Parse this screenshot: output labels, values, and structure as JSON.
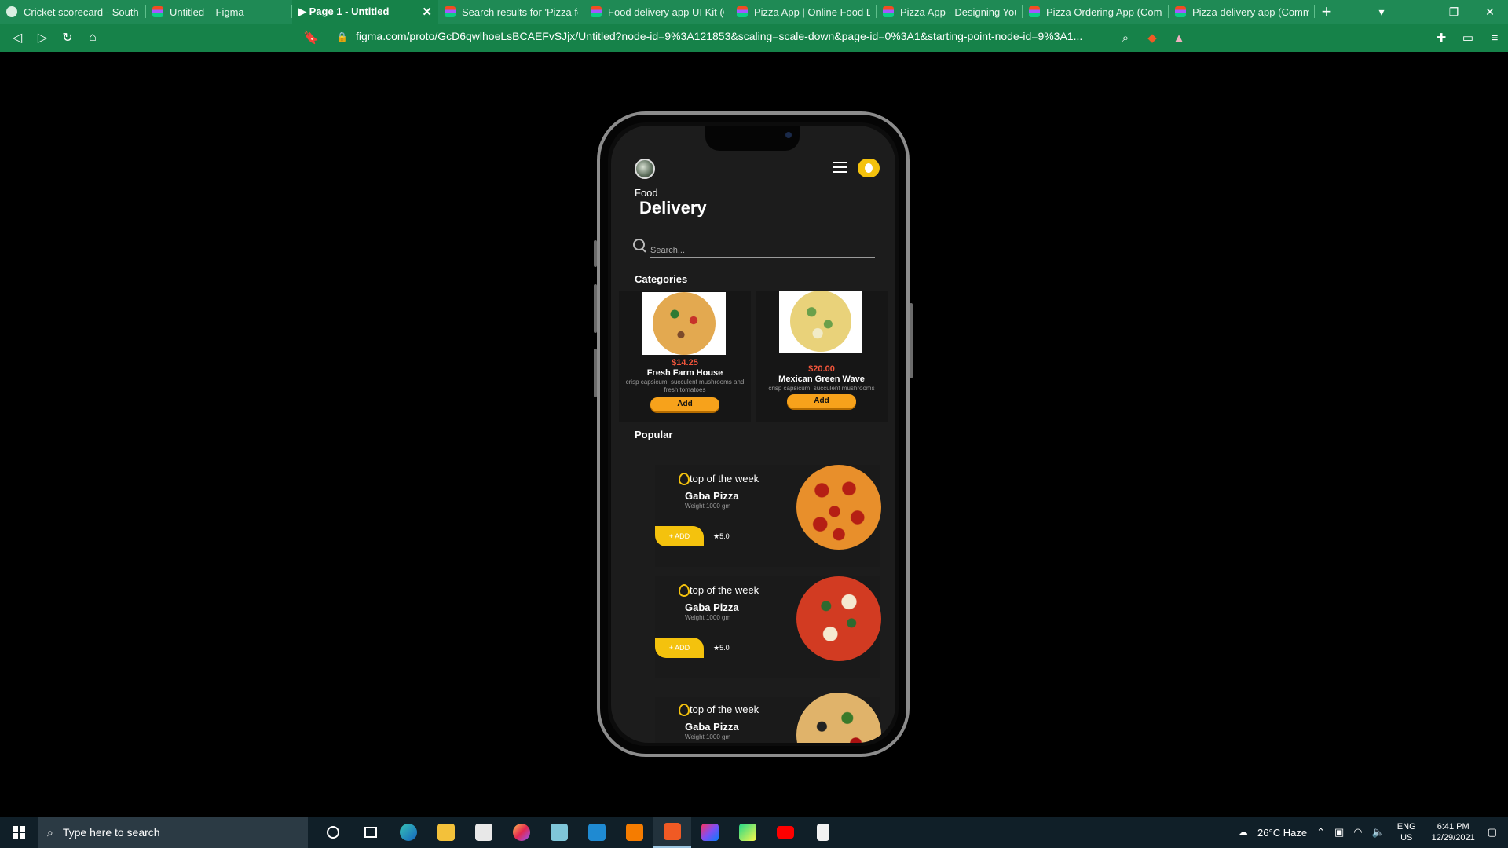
{
  "browser": {
    "tabs": [
      {
        "title": "Cricket scorecard - South Af",
        "icon": "cricket-favicon",
        "active": false
      },
      {
        "title": "Untitled – Figma",
        "icon": "figma-favicon",
        "active": false
      },
      {
        "title": "▶ Page 1 - Untitled",
        "icon": "figma-favicon",
        "active": true,
        "close": "✕"
      },
      {
        "title": "Search results for 'Pizza foo",
        "icon": "figma-favicon",
        "active": false
      },
      {
        "title": "Food delivery app UI Kit (Co",
        "icon": "figma-favicon",
        "active": false
      },
      {
        "title": "Pizza App | Online Food Del",
        "icon": "figma-favicon",
        "active": false
      },
      {
        "title": "Pizza App - Designing Your",
        "icon": "figma-favicon",
        "active": false
      },
      {
        "title": "Pizza Ordering App (Comm",
        "icon": "figma-favicon",
        "active": false
      },
      {
        "title": "Pizza delivery app (Commun",
        "icon": "figma-favicon",
        "active": false
      }
    ],
    "new_tab": "+",
    "window_controls": {
      "menu": "▾",
      "minimize": "—",
      "restore": "❐",
      "close": "✕"
    },
    "nav": {
      "back": "◁",
      "forward": "▷",
      "reload": "↻",
      "home": "⌂",
      "bookmark": "🔖"
    },
    "url": "figma.com/proto/GcD6qwlhoeLsBCAEFvSJjx/Untitled?node-id=9%3A121853&scaling=scale-down&page-id=0%3A1&starting-point-node-id=9%3A1...",
    "accent_color": "#1f8a55"
  },
  "app": {
    "heading_small": "Food",
    "heading_big": "Delivery",
    "search_placeholder": "Search...",
    "categories_title": "Categories",
    "categories": [
      {
        "price": "$14.25",
        "name": "Fresh Farm House",
        "desc": "crisp capsicum, succulent mushrooms and fresh tomatoes",
        "button": "Add"
      },
      {
        "price": "$20.00",
        "name": "Mexican Green Wave",
        "desc": "crisp capsicum, succulent mushrooms",
        "button": "Add"
      }
    ],
    "popular_title": "Popular",
    "popular": [
      {
        "badge": "top of the week",
        "name": "Gaba Pizza",
        "weight": "Weight 1000 gm",
        "add": "+ ADD",
        "rating": "★5.0"
      },
      {
        "badge": "top of the week",
        "name": "Gaba Pizza",
        "weight": "Weight 1000 gm",
        "add": "+ ADD",
        "rating": "★5.0"
      },
      {
        "badge": "top of the week",
        "name": "Gaba Pizza",
        "weight": "Weight 1000 gm"
      }
    ],
    "colors": {
      "price": "#f2553b",
      "add_button": "#f7a21b",
      "accent": "#f4c20d",
      "background": "#1c1c1c"
    }
  },
  "taskbar": {
    "search_placeholder": "Type here to search",
    "weather": "26°C  Haze",
    "language": "ENG",
    "region": "US",
    "time": "6:41 PM",
    "date": "12/29/2021"
  }
}
